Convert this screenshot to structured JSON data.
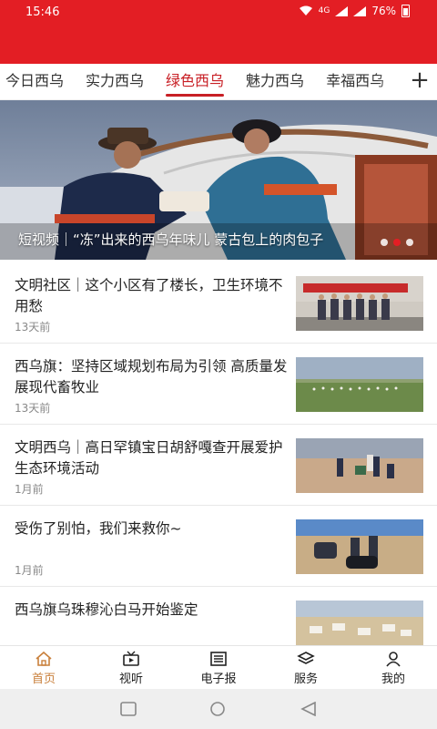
{
  "status_bar": {
    "time": "15:46",
    "network": "4G",
    "battery": "76%"
  },
  "tabs": [
    {
      "label": "今日西乌"
    },
    {
      "label": "实力西乌"
    },
    {
      "label": "绿色西乌",
      "active": true
    },
    {
      "label": "魅力西乌"
    },
    {
      "label": "幸福西乌"
    }
  ],
  "add_tab_label": "+",
  "banner": {
    "caption": "短视频｜“冻”出来的西乌年味儿 蒙古包上的肉包子",
    "dots": 3,
    "active_dot": 1
  },
  "news": [
    {
      "title": "文明社区｜这个小区有了楼长，卫生环境不用愁",
      "time": "13天前"
    },
    {
      "title": "西乌旗：坚持区域规划布局为引领 高质量发展现代畜牧业",
      "time": "13天前"
    },
    {
      "title": "文明西乌｜高日罕镇宝日胡舒嘎查开展爱护生态环境活动",
      "time": "1月前"
    },
    {
      "title": "受伤了别怕，我们来救你~",
      "time": "1月前"
    },
    {
      "title": "西乌旗乌珠穆沁白马开始鉴定",
      "time": ""
    }
  ],
  "bottom_nav": [
    {
      "label": "首页",
      "icon": "home-icon",
      "active": true
    },
    {
      "label": "视听",
      "icon": "video-icon"
    },
    {
      "label": "电子报",
      "icon": "newspaper-icon"
    },
    {
      "label": "服务",
      "icon": "layers-icon"
    },
    {
      "label": "我的",
      "icon": "user-icon"
    }
  ],
  "colors": {
    "brand_red": "#e31e24",
    "tab_active": "#c81f25",
    "nav_active": "#c9803c"
  }
}
